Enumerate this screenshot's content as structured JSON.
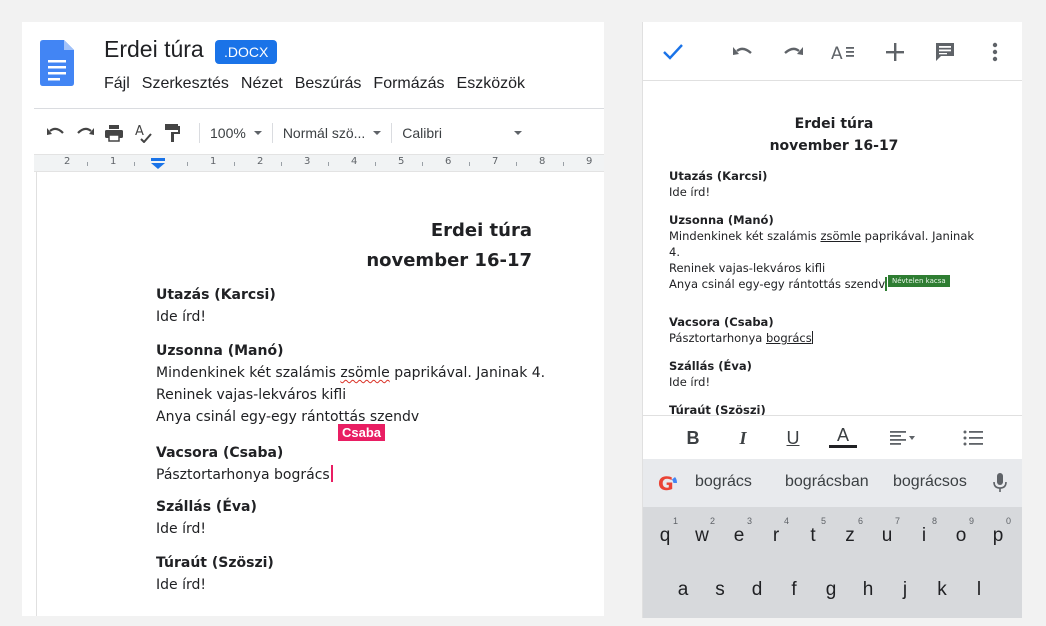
{
  "desktop": {
    "title": "Erdei túra",
    "badge": ".DOCX",
    "menu": [
      "Fájl",
      "Szerkesztés",
      "Nézet",
      "Beszúrás",
      "Formázás",
      "Eszközök"
    ],
    "toolbar": {
      "zoom": "100%",
      "style": "Normál szö...",
      "font": "Calibri"
    },
    "ruler": [
      "2",
      "1",
      "1",
      "2",
      "3",
      "4",
      "5",
      "6",
      "7",
      "8",
      "9"
    ],
    "doc": {
      "heading1": "Erdei túra",
      "heading2": "november 16-17",
      "sections": [
        {
          "title": "Utazás (Karcsi)",
          "lines": [
            "Ide írd!"
          ]
        },
        {
          "title": "Uzsonna (Manó)",
          "lines": [
            "Mindenkinek két szalámis ",
            "zsömle",
            " paprikával. Janinak 4.",
            "Reninek vajas-lekváros kifli",
            "Anya csinál egy-egy rántottás szendv"
          ]
        },
        {
          "title": "Vacsora (Csaba)",
          "lines": [
            "Pásztortarhonya bogrács"
          ]
        },
        {
          "title": "Szállás (Éva)",
          "lines": [
            "Ide írd!"
          ]
        },
        {
          "title": "Túraút (Szöszi)",
          "lines": [
            "Ide írd!"
          ]
        }
      ],
      "collaborator": "Csaba"
    },
    "colors": {
      "accent": "#1a73e8",
      "collab": "#e91e63"
    }
  },
  "mobile": {
    "doc": {
      "heading1": "Erdei túra",
      "heading2": "november 16-17",
      "utazas_title": "Utazás (Karcsi)",
      "utazas_text": "Ide írd!",
      "uzsonna_title": "Uzsonna (Manó)",
      "uzsonna_l1a": "Mindenkinek két szalámis ",
      "uzsonna_l1b": "zsömle",
      "uzsonna_l1c": " paprikával. Janinak",
      "uzsonna_l2": "4.",
      "uzsonna_l3": "Reninek vajas-lekváros kifli",
      "uzsonna_l4": "Anya csinál egy-egy rántottás szendv",
      "vacsora_title": "Vacsora (Csaba)",
      "vacsora_a": "Pásztortarhonya ",
      "vacsora_b": "bogrács",
      "szallas_title": "Szállás (Éva)",
      "szallas_text": "Ide írd!",
      "turaut_title": "Túraút (Szöszi)"
    },
    "collaborator": "Névtelen kacsa",
    "format": {
      "bold": "B",
      "italic": "I",
      "underline": "U",
      "color": "A"
    },
    "keyboard": {
      "suggestions": [
        "bogrács",
        "bográcsban",
        "bográcsos"
      ],
      "row1": [
        "q",
        "w",
        "e",
        "r",
        "t",
        "z",
        "u",
        "i",
        "o",
        "p"
      ],
      "row1_hints": [
        "1",
        "2",
        "3",
        "4",
        "5",
        "6",
        "7",
        "8",
        "9",
        "0"
      ],
      "row2": [
        "a",
        "s",
        "d",
        "f",
        "g",
        "h",
        "j",
        "k",
        "l"
      ]
    },
    "colors": {
      "check": "#1a73e8",
      "collab": "#2e7d32"
    }
  }
}
